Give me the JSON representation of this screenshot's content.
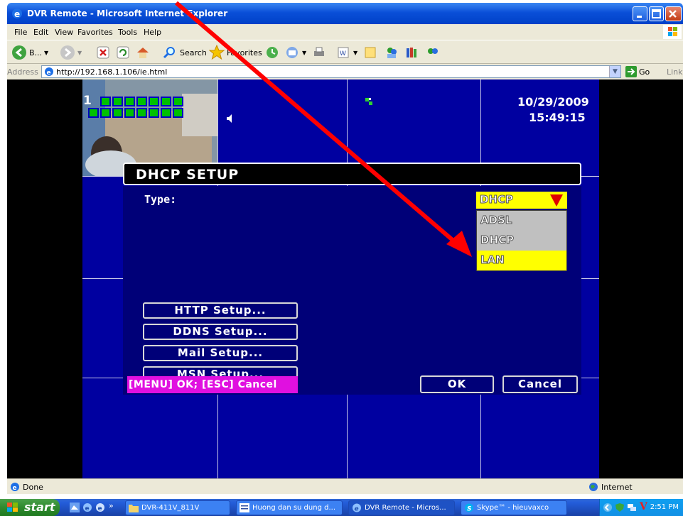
{
  "window": {
    "title": "DVR Remote - Microsoft Internet Explorer"
  },
  "menubar": {
    "items": [
      "File",
      "Edit",
      "View",
      "Favorites",
      "Tools",
      "Help"
    ]
  },
  "toolbar": {
    "back_label": "B...",
    "search_label": "Search",
    "favorites_label": "Favorites"
  },
  "addressbar": {
    "label": "Address",
    "url": "http://192.168.1.106/ie.html",
    "go_label": "Go",
    "links_label": "Links"
  },
  "dvr": {
    "channel_number": "1",
    "date": "10/29/2009",
    "time": "15:49:15"
  },
  "dialog": {
    "title": "DHCP SETUP",
    "type_label": "Type:",
    "type_value": "DHCP",
    "type_options": [
      "ADSL",
      "DHCP",
      "LAN"
    ],
    "type_highlighted": "LAN",
    "buttons": {
      "http": "HTTP Setup...",
      "ddns": "DDNS Setup...",
      "mail": "Mail Setup...",
      "msn": "MSN Setup...",
      "ok": "OK",
      "cancel": "Cancel"
    },
    "hint": "[MENU] OK; [ESC] Cancel"
  },
  "statusbar": {
    "status": "Done",
    "zone": "Internet"
  },
  "taskbar": {
    "start_label": "start",
    "tasks": [
      "DVR-411V_811V",
      "Huong dan su dung d...",
      "DVR Remote - Micros...",
      "Skype™ - hieuvaxco"
    ],
    "clock": "2:51 PM"
  },
  "colors": {
    "dvr_background": "#0000a0",
    "dialog_body": "#000078",
    "highlight_yellow": "#ffff00",
    "hint_magenta": "#e010e0",
    "annotation_arrow": "#ff0000",
    "xp_titlebar": "#0a4fd8"
  }
}
